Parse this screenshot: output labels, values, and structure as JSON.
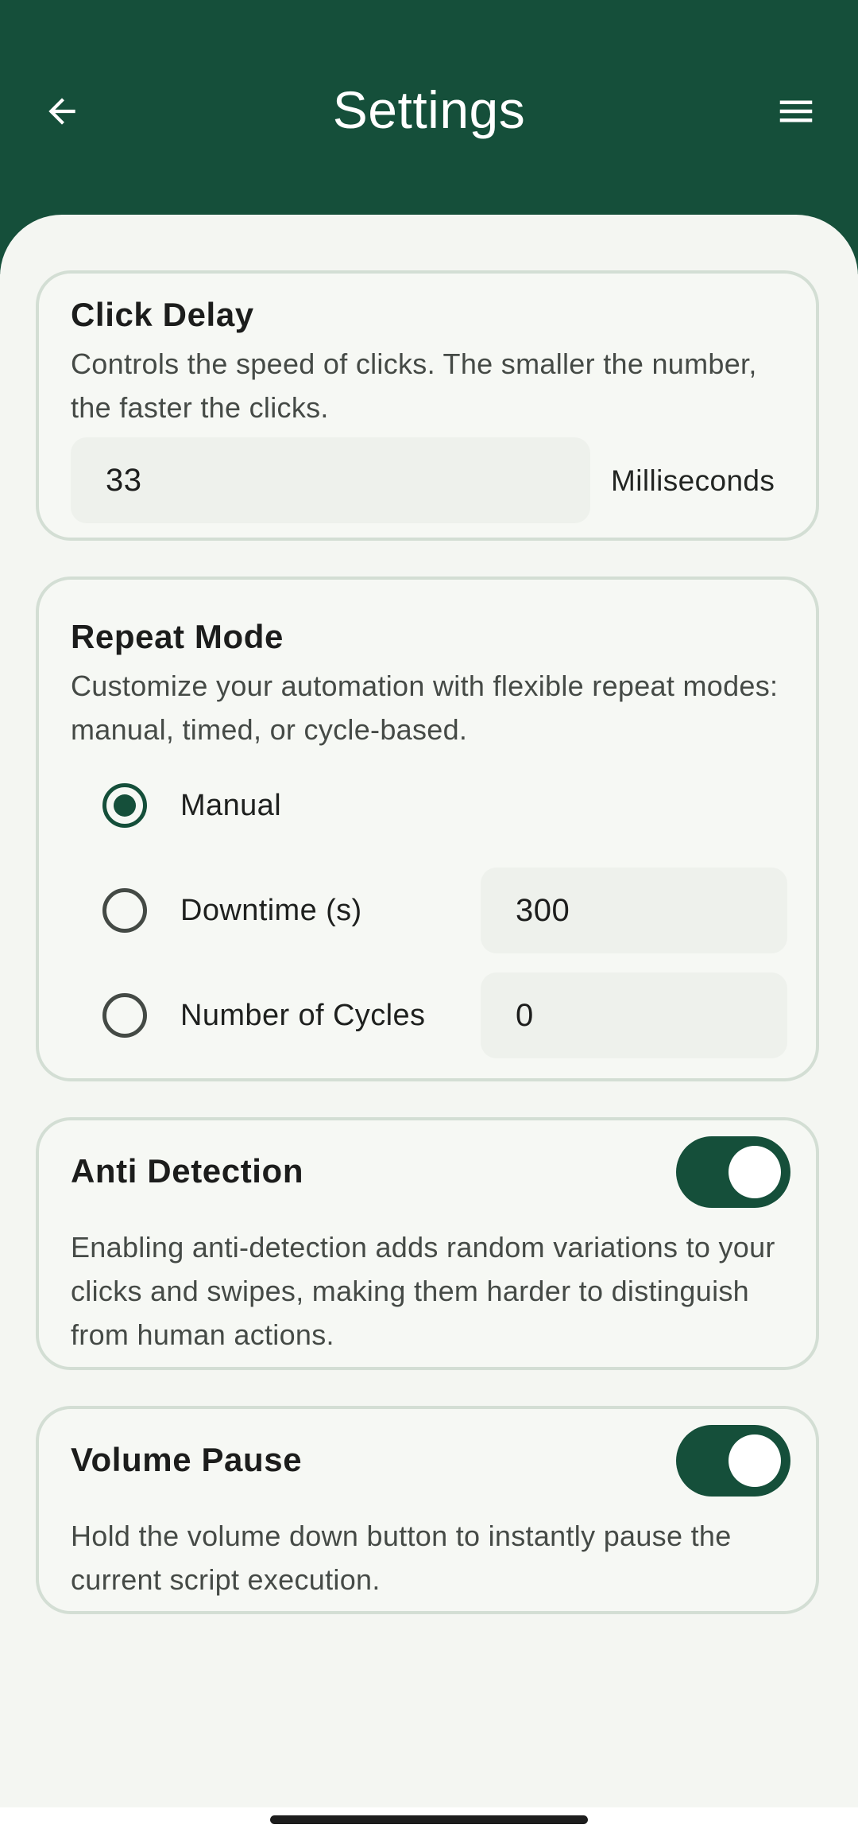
{
  "app_bar": {
    "title": "Settings",
    "back_icon": "arrow-left-icon",
    "menu_icon": "hamburger-menu-icon",
    "background": "#154f3a"
  },
  "click_delay": {
    "title": "Click Delay",
    "description": "Controls the speed of clicks. The smaller the number, the faster the clicks.",
    "value": "33",
    "unit": "Milliseconds"
  },
  "repeat_mode": {
    "title": "Repeat Mode",
    "description": "Customize your automation with flexible repeat modes: manual, timed, or cycle-based.",
    "selected": "Manual",
    "options": [
      {
        "label": "Manual",
        "checked": true
      },
      {
        "label": "Downtime (s)",
        "checked": false,
        "value": "300"
      },
      {
        "label": "Number of Cycles",
        "checked": false,
        "value": "0"
      }
    ]
  },
  "anti_detection": {
    "title": "Anti Detection",
    "description": "Enabling anti-detection adds random variations to your clicks and swipes, making them harder to distinguish from human actions.",
    "enabled": true
  },
  "volume_pause": {
    "title": "Volume Pause",
    "description": "Hold the volume down button to instantly pause the current script execution.",
    "enabled": true
  },
  "colors": {
    "accent": "#154f3a",
    "card_border": "#d3ded4",
    "field_background": "#eef1ec",
    "page_background": "#f4f6f2"
  }
}
